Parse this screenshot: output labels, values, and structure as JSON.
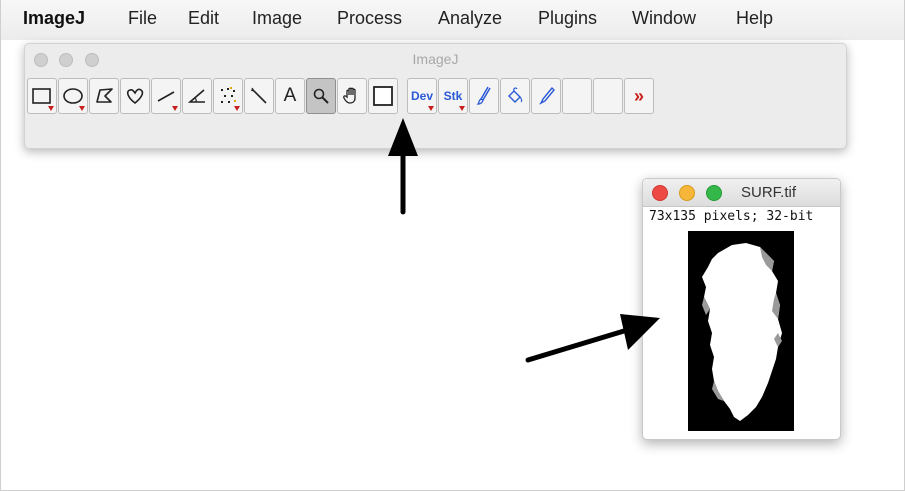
{
  "menubar": {
    "app": "ImageJ",
    "items": [
      "File",
      "Edit",
      "Image",
      "Process",
      "Analyze",
      "Plugins",
      "Window",
      "Help"
    ]
  },
  "toolbar_window": {
    "title": "ImageJ",
    "tools": [
      {
        "name": "rectangle-tool",
        "icon": "rectangle-icon"
      },
      {
        "name": "oval-tool",
        "icon": "oval-icon"
      },
      {
        "name": "polygon-tool",
        "icon": "polygon-icon"
      },
      {
        "name": "freehand-tool",
        "icon": "freehand-icon"
      },
      {
        "name": "line-tool",
        "icon": "line-icon"
      },
      {
        "name": "angle-tool",
        "icon": "angle-icon"
      },
      {
        "name": "point-tool",
        "icon": "multipoint-icon"
      },
      {
        "name": "wand-tool",
        "icon": "wand-icon"
      },
      {
        "name": "text-tool",
        "icon": "text-icon",
        "label": "A"
      },
      {
        "name": "zoom-tool",
        "icon": "magnifier-icon",
        "selected": true
      },
      {
        "name": "hand-tool",
        "icon": "hand-icon"
      },
      {
        "name": "color-picker-tool",
        "icon": "color-picker-icon"
      },
      {
        "name": "developer-menu",
        "icon": "dev-icon",
        "label": "Dev"
      },
      {
        "name": "stack-menu",
        "icon": "stk-icon",
        "label": "Stk"
      },
      {
        "name": "brush-tool",
        "icon": "brush-icon"
      },
      {
        "name": "flood-fill-tool",
        "icon": "flood-fill-icon"
      },
      {
        "name": "pencil-tool",
        "icon": "pencil-icon"
      },
      {
        "name": "empty-slot-1",
        "icon": "blank"
      },
      {
        "name": "empty-slot-2",
        "icon": "blank"
      },
      {
        "name": "more-tools",
        "icon": "double-chevron-icon",
        "label": "»"
      }
    ],
    "selected_tool": "zoom-tool"
  },
  "image_window": {
    "title": "SURF.tif",
    "info": "73x135 pixels; 32-bit"
  },
  "colors": {
    "accent_blue": "#2a5ad6",
    "menu_red": "#c8201c",
    "close": "#ec4a42",
    "minimize": "#f6b63a",
    "maximize": "#35b84a"
  }
}
